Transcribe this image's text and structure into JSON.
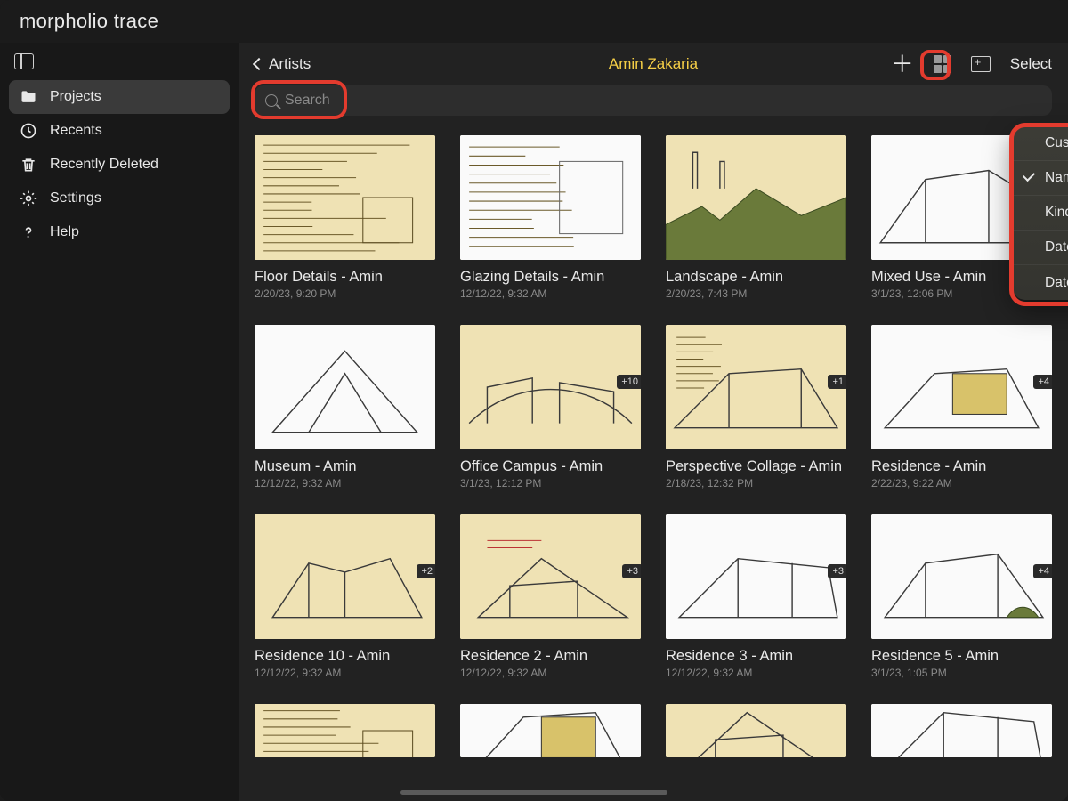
{
  "brand": {
    "word1": "morpholio",
    "word2": "trace"
  },
  "sidebar": {
    "items": [
      {
        "label": "Projects"
      },
      {
        "label": "Recents"
      },
      {
        "label": "Recently Deleted"
      },
      {
        "label": "Settings"
      },
      {
        "label": "Help"
      }
    ]
  },
  "toolbar": {
    "back_label": "Artists",
    "title": "Amin Zakaria",
    "select_label": "Select"
  },
  "search": {
    "placeholder": "Search"
  },
  "sort_menu": {
    "options": [
      {
        "label": "Custom",
        "selected": false
      },
      {
        "label": "Name",
        "selected": true,
        "ascending": true
      },
      {
        "label": "Kind",
        "selected": false
      },
      {
        "label": "Date Created",
        "selected": false
      },
      {
        "label": "Date Modified",
        "selected": false
      }
    ]
  },
  "projects": [
    {
      "title": "Floor Details - Amin",
      "date": "2/20/23, 9:20 PM",
      "badge": "",
      "variant": "notes-tan"
    },
    {
      "title": "Glazing Details - Amin",
      "date": "12/12/22, 9:32 AM",
      "badge": "",
      "variant": "notes-white"
    },
    {
      "title": "Landscape - Amin",
      "date": "2/20/23, 7:43 PM",
      "badge": "",
      "variant": "landscape"
    },
    {
      "title": "Mixed Use - Amin",
      "date": "3/1/23, 12:06 PM",
      "badge": "",
      "variant": "building-a"
    },
    {
      "title": "Museum - Amin",
      "date": "12/12/22, 9:32 AM",
      "badge": "",
      "variant": "museum"
    },
    {
      "title": "Office Campus - Amin",
      "date": "3/1/23, 12:12 PM",
      "badge": "+10",
      "variant": "campus"
    },
    {
      "title": "Perspective Collage - Amin",
      "date": "2/18/23, 12:32 PM",
      "badge": "+1",
      "variant": "collage"
    },
    {
      "title": "Residence - Amin",
      "date": "2/22/23, 9:22 AM",
      "badge": "+4",
      "variant": "residence-a"
    },
    {
      "title": "Residence 10 - Amin",
      "date": "12/12/22, 9:32 AM",
      "badge": "+2",
      "variant": "residence-b"
    },
    {
      "title": "Residence 2 - Amin",
      "date": "12/12/22, 9:32 AM",
      "badge": "+3",
      "variant": "residence-c"
    },
    {
      "title": "Residence 3 - Amin",
      "date": "12/12/22, 9:32 AM",
      "badge": "+3",
      "variant": "residence-d"
    },
    {
      "title": "Residence 5 - Amin",
      "date": "3/1/23, 1:05 PM",
      "badge": "+4",
      "variant": "residence-e"
    }
  ]
}
